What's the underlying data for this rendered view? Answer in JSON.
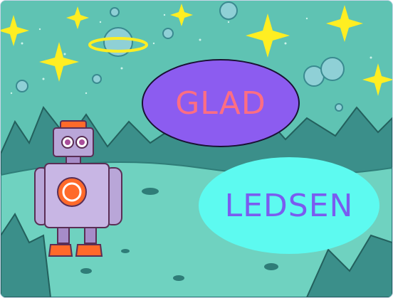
{
  "stage": {
    "bubble_happy": {
      "label": "GLAD",
      "fill": "#8c5cf0",
      "text_color": "#ff6e82"
    },
    "bubble_sad": {
      "label": "LEDSEN",
      "fill": "#5dfaf0",
      "text_color": "#7a5cf0"
    },
    "backdrop": {
      "sky_color": "#5fc3b3",
      "ground_color": "#6fd2c0"
    },
    "sprite": {
      "name": "robot-icon",
      "body_color": "#b9a6d8",
      "accent_color": "#ff6a2a"
    }
  }
}
